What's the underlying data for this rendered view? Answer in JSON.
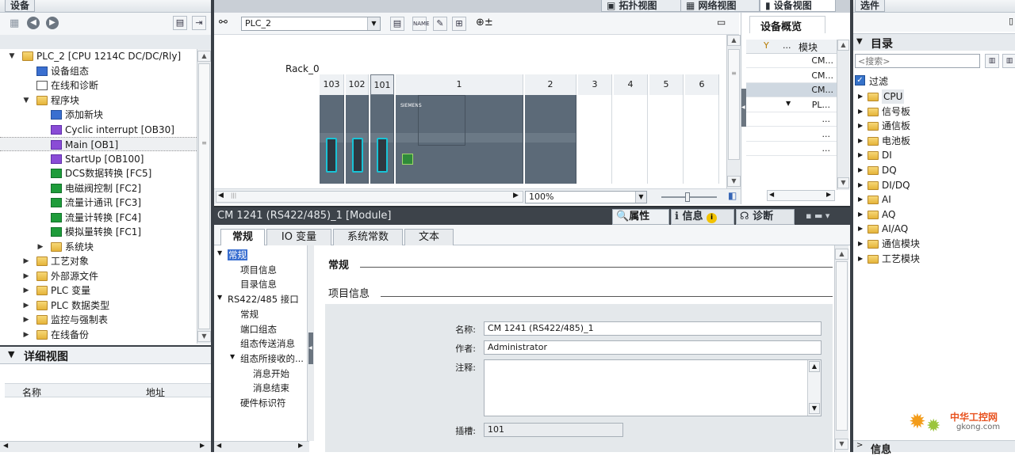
{
  "left_panel": {
    "title": "设备",
    "tree": [
      {
        "label": "PLC_2 [CPU 1214C DC/DC/Rly]",
        "level": 1,
        "icon": "plc-icon",
        "expanded": true
      },
      {
        "label": "设备组态",
        "level": 2,
        "icon": "device-config-icon"
      },
      {
        "label": "在线和诊断",
        "level": 2,
        "icon": "online-diag-icon"
      },
      {
        "label": "程序块",
        "level": 2,
        "icon": "folder-icon",
        "expanded": true
      },
      {
        "label": "添加新块",
        "level": 3,
        "icon": "add-block-icon"
      },
      {
        "label": "Cyclic interrupt [OB30]",
        "level": 3,
        "icon": "ob-icon"
      },
      {
        "label": "Main [OB1]",
        "level": 3,
        "icon": "ob-icon",
        "selected": true
      },
      {
        "label": "StartUp [OB100]",
        "level": 3,
        "icon": "ob-icon"
      },
      {
        "label": "DCS数据转换 [FC5]",
        "level": 3,
        "icon": "fc-icon"
      },
      {
        "label": "电磁阀控制 [FC2]",
        "level": 3,
        "icon": "fc-icon"
      },
      {
        "label": "流量计通讯 [FC3]",
        "level": 3,
        "icon": "fc-icon"
      },
      {
        "label": "流量计转换 [FC4]",
        "level": 3,
        "icon": "fc-icon"
      },
      {
        "label": "模拟量转换 [FC1]",
        "level": 3,
        "icon": "fc-icon"
      },
      {
        "label": "系统块",
        "level": 3,
        "icon": "folder-icon",
        "collapsed": true
      },
      {
        "label": "工艺对象",
        "level": 2,
        "icon": "folder-icon",
        "collapsed": true
      },
      {
        "label": "外部源文件",
        "level": 2,
        "icon": "folder-icon",
        "collapsed": true
      },
      {
        "label": "PLC 变量",
        "level": 2,
        "icon": "folder-icon",
        "collapsed": true
      },
      {
        "label": "PLC 数据类型",
        "level": 2,
        "icon": "folder-icon",
        "collapsed": true
      },
      {
        "label": "监控与强制表",
        "level": 2,
        "icon": "folder-icon",
        "collapsed": true
      },
      {
        "label": "在线备份",
        "level": 2,
        "icon": "folder-icon",
        "collapsed": true
      }
    ],
    "detail_view": {
      "title": "详细视图",
      "columns": [
        "名称",
        "地址"
      ]
    }
  },
  "view_tabs": [
    "拓扑视图",
    "网络视图",
    "设备视图"
  ],
  "device_view": {
    "device_select": "PLC_2",
    "rack_label": "Rack_0",
    "slots": [
      "103",
      "102",
      "101",
      "1",
      "2",
      "3",
      "4",
      "5",
      "6"
    ],
    "zoom": "100%",
    "cpu_brand": "SIEMENS"
  },
  "device_overview": {
    "title": "设备概览",
    "column": "模块",
    "rows": [
      "CM...",
      "CM...",
      "CM...",
      "PL...",
      "...",
      "...",
      "..."
    ]
  },
  "properties": {
    "title": "CM 1241 (RS422/485)_1 [Module]",
    "top_tabs": [
      "属性",
      "信息",
      "诊断"
    ],
    "tabs": [
      "常规",
      "IO 变量",
      "系统常数",
      "文本"
    ],
    "nav": [
      {
        "label": "常规",
        "level": 0,
        "expanded": true,
        "selected": true
      },
      {
        "label": "项目信息",
        "level": 1
      },
      {
        "label": "目录信息",
        "level": 1
      },
      {
        "label": "RS422/485 接口",
        "level": 0,
        "expanded": true
      },
      {
        "label": "常规",
        "level": 1
      },
      {
        "label": "端口组态",
        "level": 1
      },
      {
        "label": "组态传送消息",
        "level": 1
      },
      {
        "label": "组态所接收的...",
        "level": 1,
        "expanded": true
      },
      {
        "label": "消息开始",
        "level": 2
      },
      {
        "label": "消息结束",
        "level": 2
      },
      {
        "label": "硬件标识符",
        "level": 1
      }
    ],
    "section_title": "常规",
    "subsection_title": "项目信息",
    "fields": {
      "name_label": "名称:",
      "name_value": "CM 1241 (RS422/485)_1",
      "author_label": "作者:",
      "author_value": "Administrator",
      "comment_label": "注释:",
      "comment_value": "",
      "slot_label": "插槽:",
      "slot_value": "101"
    }
  },
  "right_panel": {
    "title": "选件",
    "catalog_title": "目录",
    "search_placeholder": "<搜索>",
    "filter_label": "过滤",
    "categories": [
      "CPU",
      "信号板",
      "通信板",
      "电池板",
      "DI",
      "DQ",
      "DI/DQ",
      "AI",
      "AQ",
      "AI/AQ",
      "通信模块",
      "工艺模块"
    ],
    "info_title": "信息"
  },
  "watermark": {
    "text": "中华工控网",
    "sub": "gkong.com"
  }
}
